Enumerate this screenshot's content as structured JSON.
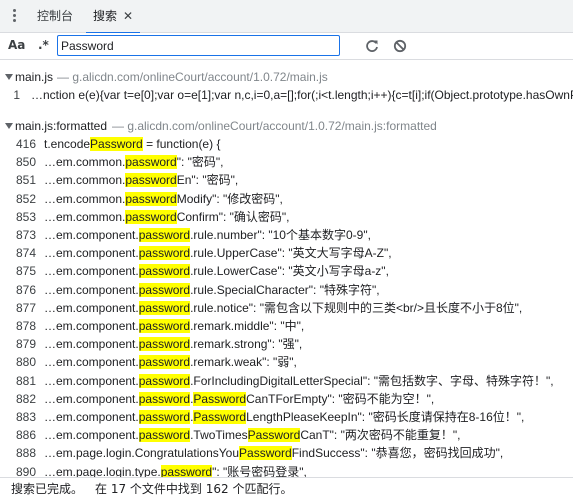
{
  "tabs": {
    "console_label": "控制台",
    "search_label": "搜索",
    "close_glyph": "✕"
  },
  "search": {
    "case_label": "Aa",
    "regex_label": ".*",
    "query": "Password"
  },
  "icons": {
    "menu": "kebab-menu-icon",
    "refresh": "refresh-icon",
    "clear": "clear-icon"
  },
  "colors": {
    "highlight": "#ffff00",
    "accent": "#1a73e8",
    "path": "#80868b"
  },
  "results": {
    "file1": {
      "name": "main.js",
      "path": "— g.alicdn.com/onlineCourt/account/1.0.72/main.js",
      "match": {
        "line": "1",
        "text": "…nction e(e){var t=e[0];var o=e[1];var n,c,i=0,a=[];for(;i<t.length;i++){c=t[i];if(Object.prototype.hasOwnPr"
      }
    },
    "file2": {
      "name": "main.js:formatted",
      "path": "— g.alicdn.com/onlineCourt/account/1.0.72/main.js:formatted",
      "matches": [
        {
          "line": "416",
          "parts": [
            "t.encode",
            "Password",
            " = function(e) {"
          ]
        },
        {
          "line": "850",
          "parts": [
            "…em.common.",
            "password",
            "\": \"密码\","
          ]
        },
        {
          "line": "851",
          "parts": [
            "…em.common.",
            "password",
            "En\": \"密码\","
          ]
        },
        {
          "line": "852",
          "parts": [
            "…em.common.",
            "password",
            "Modify\": \"修改密码\","
          ]
        },
        {
          "line": "853",
          "parts": [
            "…em.common.",
            "password",
            "Confirm\": \"确认密码\","
          ]
        },
        {
          "line": "873",
          "parts": [
            "…em.component.",
            "password",
            ".rule.number\": \"10个基本数字0-9\","
          ]
        },
        {
          "line": "874",
          "parts": [
            "…em.component.",
            "password",
            ".rule.UpperCase\": \"英文大写字母A-Z\","
          ]
        },
        {
          "line": "875",
          "parts": [
            "…em.component.",
            "password",
            ".rule.LowerCase\": \"英文小写字母a-z\","
          ]
        },
        {
          "line": "876",
          "parts": [
            "…em.component.",
            "password",
            ".rule.SpecialCharacter\": \"特殊字符\","
          ]
        },
        {
          "line": "877",
          "parts": [
            "…em.component.",
            "password",
            ".rule.notice\": \"需包含以下规则中的三类<br/>且长度不小于8位\","
          ]
        },
        {
          "line": "878",
          "parts": [
            "…em.component.",
            "password",
            ".remark.middle\": \"中\","
          ]
        },
        {
          "line": "879",
          "parts": [
            "…em.component.",
            "password",
            ".remark.strong\": \"强\","
          ]
        },
        {
          "line": "880",
          "parts": [
            "…em.component.",
            "password",
            ".remark.weak\": \"弱\","
          ]
        },
        {
          "line": "881",
          "parts": [
            "…em.component.",
            "password",
            ".ForIncludingDigitalLetterSpecial\": \"需包括数字、字母、特殊字符！\","
          ]
        },
        {
          "line": "882",
          "parts": [
            "…em.component.",
            "password",
            ".",
            "Password",
            "CanTForEmpty\": \"密码不能为空！\","
          ]
        },
        {
          "line": "883",
          "parts": [
            "…em.component.",
            "password",
            ".",
            "Password",
            "LengthPleaseKeepIn\": \"密码长度请保持在8-16位！\","
          ]
        },
        {
          "line": "886",
          "parts": [
            "…em.component.",
            "password",
            ".TwoTimes",
            "Password",
            "CanT\": \"两次密码不能重复！\","
          ]
        },
        {
          "line": "888",
          "parts": [
            "…em.page.login.CongratulationsYou",
            "Password",
            "FindSuccess\": \"恭喜您，密码找回成功\","
          ]
        },
        {
          "line": "890",
          "parts": [
            "…em.page.login.type.",
            "password",
            "\": \"账号密码登录\","
          ]
        }
      ]
    }
  },
  "status": {
    "done": "搜索已完成。",
    "summary": "在 17 个文件中找到 162 个匹配行。"
  }
}
